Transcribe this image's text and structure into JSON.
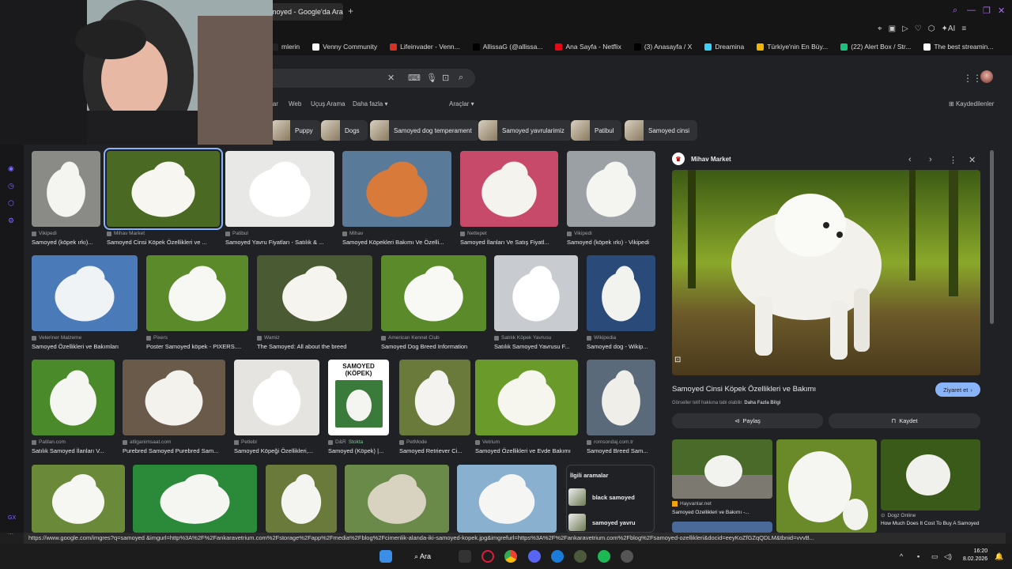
{
  "tab": {
    "title": "moyed - Google'da Ara"
  },
  "bookmarks": [
    {
      "label": "mlerin",
      "color": "#222"
    },
    {
      "label": "Venny Community",
      "color": "#ffffff"
    },
    {
      "label": "Lifeinvader - Venn...",
      "color": "#d93025"
    },
    {
      "label": "AllissaG (@allissa...",
      "color": "#000000"
    },
    {
      "label": "Ana Sayfa - Netflix",
      "color": "#e50914"
    },
    {
      "label": "(3) Anasayfa / X",
      "color": "#000000"
    },
    {
      "label": "Dreamina",
      "color": "#3ad0ff"
    },
    {
      "label": "Türkiye'nin En Büy...",
      "color": "#f2b400"
    },
    {
      "label": "(22) Alert Box / Str...",
      "color": "#19c37d"
    },
    {
      "label": "The best streamin...",
      "color": "#ffffff"
    }
  ],
  "nav": {
    "images": "lar",
    "web": "Web",
    "flights": "Uçuş Arama",
    "more": "Daha fazla",
    "tools": "Araçlar",
    "saved": "Kaydedilenler"
  },
  "chips": [
    "Puppy",
    "Dogs",
    "Samoyed dog temperament",
    "Samoyed yavrularimiz",
    "Patibul",
    "Samoyed cinsi"
  ],
  "row1": [
    {
      "source": "Vikipedi",
      "title": "Samoyed (köpek ırkı)..."
    },
    {
      "source": "Mihav Market",
      "title": "Samoyed Cinsi Köpek Özellikleri ve ..."
    },
    {
      "source": "Patibul",
      "title": "Samoyed Yavru Fiyatları - Satılık & ..."
    },
    {
      "source": "Mihav",
      "title": "Samoyed Köpekleri Bakımı Ve Özelli..."
    },
    {
      "source": "Nettepet",
      "title": "Samoyed İlanları Ve Satış Fiyatl..."
    },
    {
      "source": "Vikipedi",
      "title": "Samoyed (köpek ırkı) - Vikipedi"
    }
  ],
  "row2": [
    {
      "source": "Veteriner Malzeme",
      "title": "Samoyed Özellikleri ve Bakımları"
    },
    {
      "source": "Pixers",
      "title": "Poster Samoyed köpek - PIXERS...."
    },
    {
      "source": "Wamiz",
      "title": "The Samoyed: All about the breed"
    },
    {
      "source": "American Kennel Club",
      "title": "Samoyed Dog Breed Information"
    },
    {
      "source": "Satılık Köpek Yavrusu",
      "title": "Satılık Samoyed Yavrusu F..."
    },
    {
      "source": "Wikipedia",
      "title": "Samoyed dog - Wikip..."
    }
  ],
  "row3": [
    {
      "source": "Patilan.com",
      "title": "Satılık Samoyed İlanları V..."
    },
    {
      "source": "atliganimsaat.com",
      "title": "Purebred Samoyed Purebred Sam..."
    },
    {
      "source": "Petlebi",
      "title": "Samoyed Köpeği Özellikleri,..."
    },
    {
      "source": "D&R",
      "stock": "Stokta",
      "title": "Samoyed (Köpek) |..."
    },
    {
      "source": "PetMode",
      "title": "Samoyed Retriever Ci..."
    },
    {
      "source": "Vetrium",
      "title": "Samoyed Özellikleri ve Evde Bakımı"
    },
    {
      "source": "romsondaj.com.tr",
      "title": "Samoyed Breed Sam..."
    }
  ],
  "book": {
    "line1": "SAMOYED",
    "line2": "(KÖPEK)"
  },
  "related": {
    "heading": "İlgili aramalar",
    "items": [
      "black samoyed",
      "samoyed yavru"
    ]
  },
  "preview": {
    "site": "Mihav Market",
    "title": "Samoyed Cinsi Köpek Özellikleri ve Bakımı",
    "visit": "Ziyaret et",
    "copyright": "Görseller telif hakkına tabi olabilir.",
    "more_info": "Daha Fazla Bilgi",
    "share": "Paylaş",
    "save": "Kaydet",
    "related": [
      {
        "source": "Hayvanlar.net",
        "title": "Samoyed Özellikleri ve Bakımı -..."
      },
      {
        "source": "",
        "title": ""
      },
      {
        "source": "Dogz Online",
        "title": "How Much Does It Cost To Buy A Samoyed"
      }
    ]
  },
  "status_url": "https://www.google.com/imgres?q=samoyed &imgurl=http%3A%2F%2Fankaravetrium.com%2Fstorage%2Fapp%2Fmedia%2Fblog%2Fcimenlik-alanda-iki-samoyed-kopek.jpg&imgrefurl=https%3A%2F%2Fankaravetrium.com%2Fblog%2Fsamoyed-ozellikleri&docid=eeyKoZfGZqQDLM&tbnid=vvvB...",
  "sidebar_gx": "GX",
  "taskbar": {
    "search": "Ara",
    "time": "16:20",
    "date": "8.02.2026"
  },
  "brand_accent": "#8ab4f8"
}
